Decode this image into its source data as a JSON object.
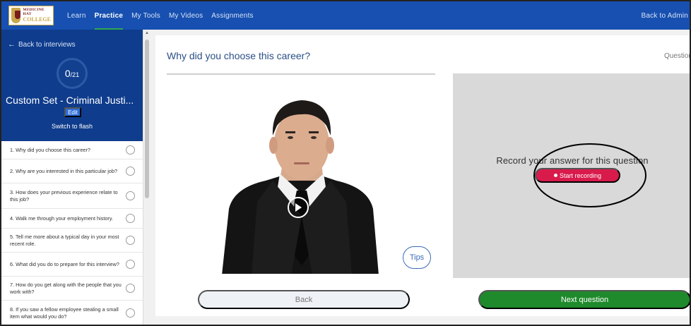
{
  "app": {
    "logo_line1": "MEDICINE HAT",
    "logo_line2": "COLLEGE"
  },
  "nav": {
    "items": [
      {
        "label": "Learn",
        "active": false
      },
      {
        "label": "Practice",
        "active": true
      },
      {
        "label": "My Tools",
        "active": false
      },
      {
        "label": "My Videos",
        "active": false
      },
      {
        "label": "Assignments",
        "active": false
      }
    ],
    "back_admin": "Back to Admin"
  },
  "sidebar": {
    "back_link": "Back to interviews",
    "progress": {
      "completed": "0",
      "total": "/21"
    },
    "set_title": "Custom Set - Criminal Justi...",
    "edit_label": "Edit",
    "switch_flash": "Switch to flash",
    "questions": [
      "1. Why did you choose this career?",
      "2. Why are you interested in this particular job?",
      "3. How does your previous experience relate to this job?",
      "4. Walk me through your employment history.",
      "5. Tell me more about a typical day in your most recent role.",
      "6. What did you do to prepare for this interview?",
      "7. How do you get along with the people that you work with?",
      "8. If you saw a fellow employee stealing a small item what would you do?"
    ]
  },
  "main": {
    "question_title": "Why did you choose this career?",
    "question_counter": "Question",
    "tips_label": "Tips",
    "record_prompt": "Record your answer for this question",
    "start_recording": "Start recording",
    "back_label": "Back",
    "next_label": "Next question"
  },
  "colors": {
    "nav_blue": "#1750b0",
    "sidebar_blue": "#0f3c8c",
    "record_red": "#d91b4c",
    "next_green": "#1f8a2c",
    "active_underline": "#2fa84f"
  }
}
